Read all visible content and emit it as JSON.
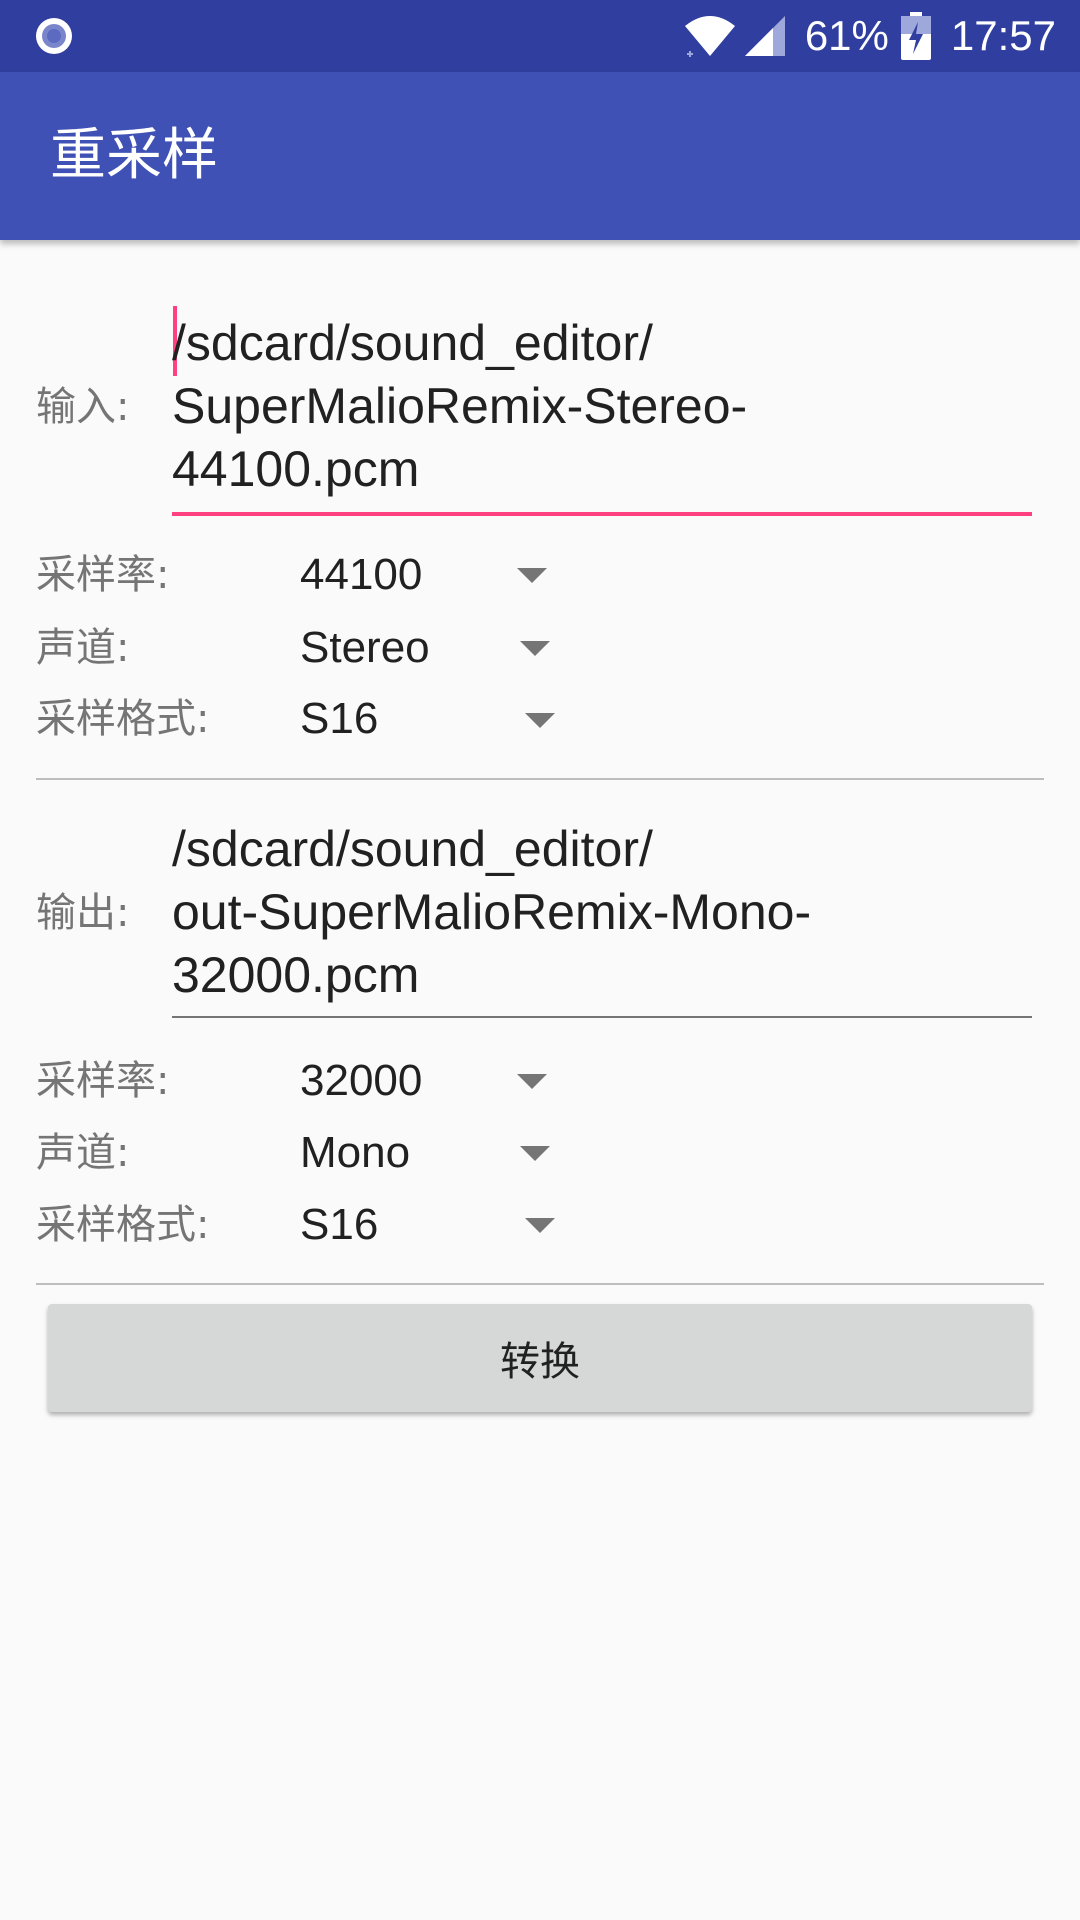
{
  "status_bar": {
    "battery": "61%",
    "time": "17:57",
    "icons": [
      "app-notification-icon",
      "wifi-icon",
      "signal-icon",
      "battery-charging-icon"
    ]
  },
  "app_bar": {
    "title": "重采样"
  },
  "input": {
    "label": "输入:",
    "path_lines": [
      "/sdcard/sound_editor/",
      "SuperMalioRemix-Stereo-",
      "44100.pcm"
    ],
    "sample_rate_label": "采样率:",
    "sample_rate": "44100",
    "channel_label": "声道:",
    "channel": "Stereo",
    "format_label": "采样格式:",
    "format": "S16"
  },
  "output": {
    "label": "输出:",
    "path_lines": [
      "/sdcard/sound_editor/",
      "out-SuperMalioRemix-Mono-",
      "32000.pcm"
    ],
    "sample_rate_label": "采样率:",
    "sample_rate": "32000",
    "channel_label": "声道:",
    "channel": "Mono",
    "format_label": "采样格式:",
    "format": "S16"
  },
  "convert_button": {
    "label": "转换"
  },
  "colors": {
    "status_bar": "#303f9f",
    "app_bar": "#3f51b5",
    "accent": "#ff4081",
    "button": "#d6d7d7",
    "background": "#fafafa"
  }
}
